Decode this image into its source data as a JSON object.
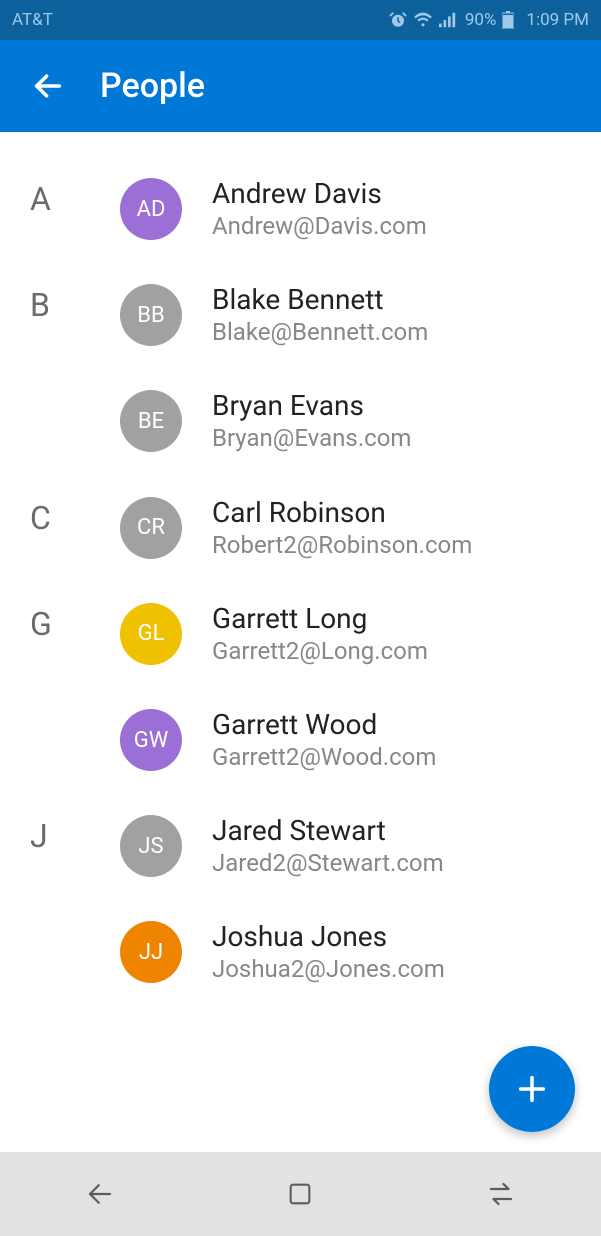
{
  "status_bar": {
    "carrier": "AT&T",
    "battery_pct": "90%",
    "time": "1:09 PM"
  },
  "header": {
    "title": "People"
  },
  "sections": [
    {
      "letter": "A",
      "contacts": [
        {
          "initials": "AD",
          "name": "Andrew Davis",
          "email": "Andrew@Davis.com",
          "color": "#9B6FD6"
        }
      ]
    },
    {
      "letter": "B",
      "contacts": [
        {
          "initials": "BB",
          "name": "Blake Bennett",
          "email": "Blake@Bennett.com",
          "color": "#A1A1A1"
        },
        {
          "initials": "BE",
          "name": "Bryan Evans",
          "email": "Bryan@Evans.com",
          "color": "#A1A1A1"
        }
      ]
    },
    {
      "letter": "C",
      "contacts": [
        {
          "initials": "CR",
          "name": "Carl Robinson",
          "email": "Robert2@Robinson.com",
          "color": "#A1A1A1"
        }
      ]
    },
    {
      "letter": "G",
      "contacts": [
        {
          "initials": "GL",
          "name": "Garrett Long",
          "email": "Garrett2@Long.com",
          "color": "#EFC100"
        },
        {
          "initials": "GW",
          "name": "Garrett Wood",
          "email": "Garrett2@Wood.com",
          "color": "#9B6FD6"
        }
      ]
    },
    {
      "letter": "J",
      "contacts": [
        {
          "initials": "JS",
          "name": "Jared Stewart",
          "email": "Jared2@Stewart.com",
          "color": "#A1A1A1"
        },
        {
          "initials": "JJ",
          "name": "Joshua Jones",
          "email": "Joshua2@Jones.com",
          "color": "#EE8400"
        }
      ]
    }
  ]
}
